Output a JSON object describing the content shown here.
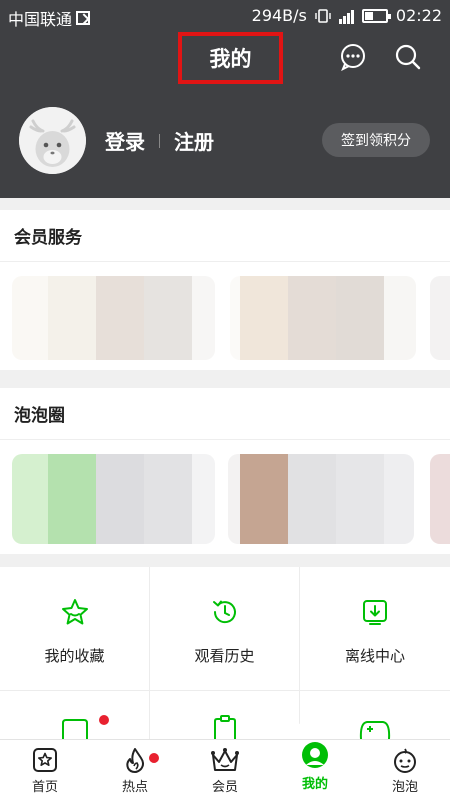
{
  "status_bar": {
    "carrier": "中国联通",
    "speed": "294B/s",
    "time": "02:22"
  },
  "header": {
    "title": "我的",
    "login_label": "登录",
    "register_label": "注册",
    "signin_button": "签到领积分"
  },
  "sections": {
    "vip": {
      "title": "会员服务"
    },
    "bubble": {
      "title": "泡泡圈"
    }
  },
  "shortcuts": [
    {
      "label": "我的收藏",
      "icon": "star-icon"
    },
    {
      "label": "观看历史",
      "icon": "history-icon"
    },
    {
      "label": "离线中心",
      "icon": "download-icon"
    }
  ],
  "tabs": [
    {
      "label": "首页",
      "icon": "home-icon"
    },
    {
      "label": "热点",
      "icon": "fire-icon"
    },
    {
      "label": "会员",
      "icon": "crown-icon"
    },
    {
      "label": "我的",
      "icon": "me-icon",
      "active": true
    },
    {
      "label": "泡泡",
      "icon": "bubble-icon"
    }
  ],
  "colors": {
    "header_bg": "#3f4043",
    "accent_green": "#00be06",
    "highlight_red": "#e11414",
    "badge_red": "#e8212f"
  }
}
